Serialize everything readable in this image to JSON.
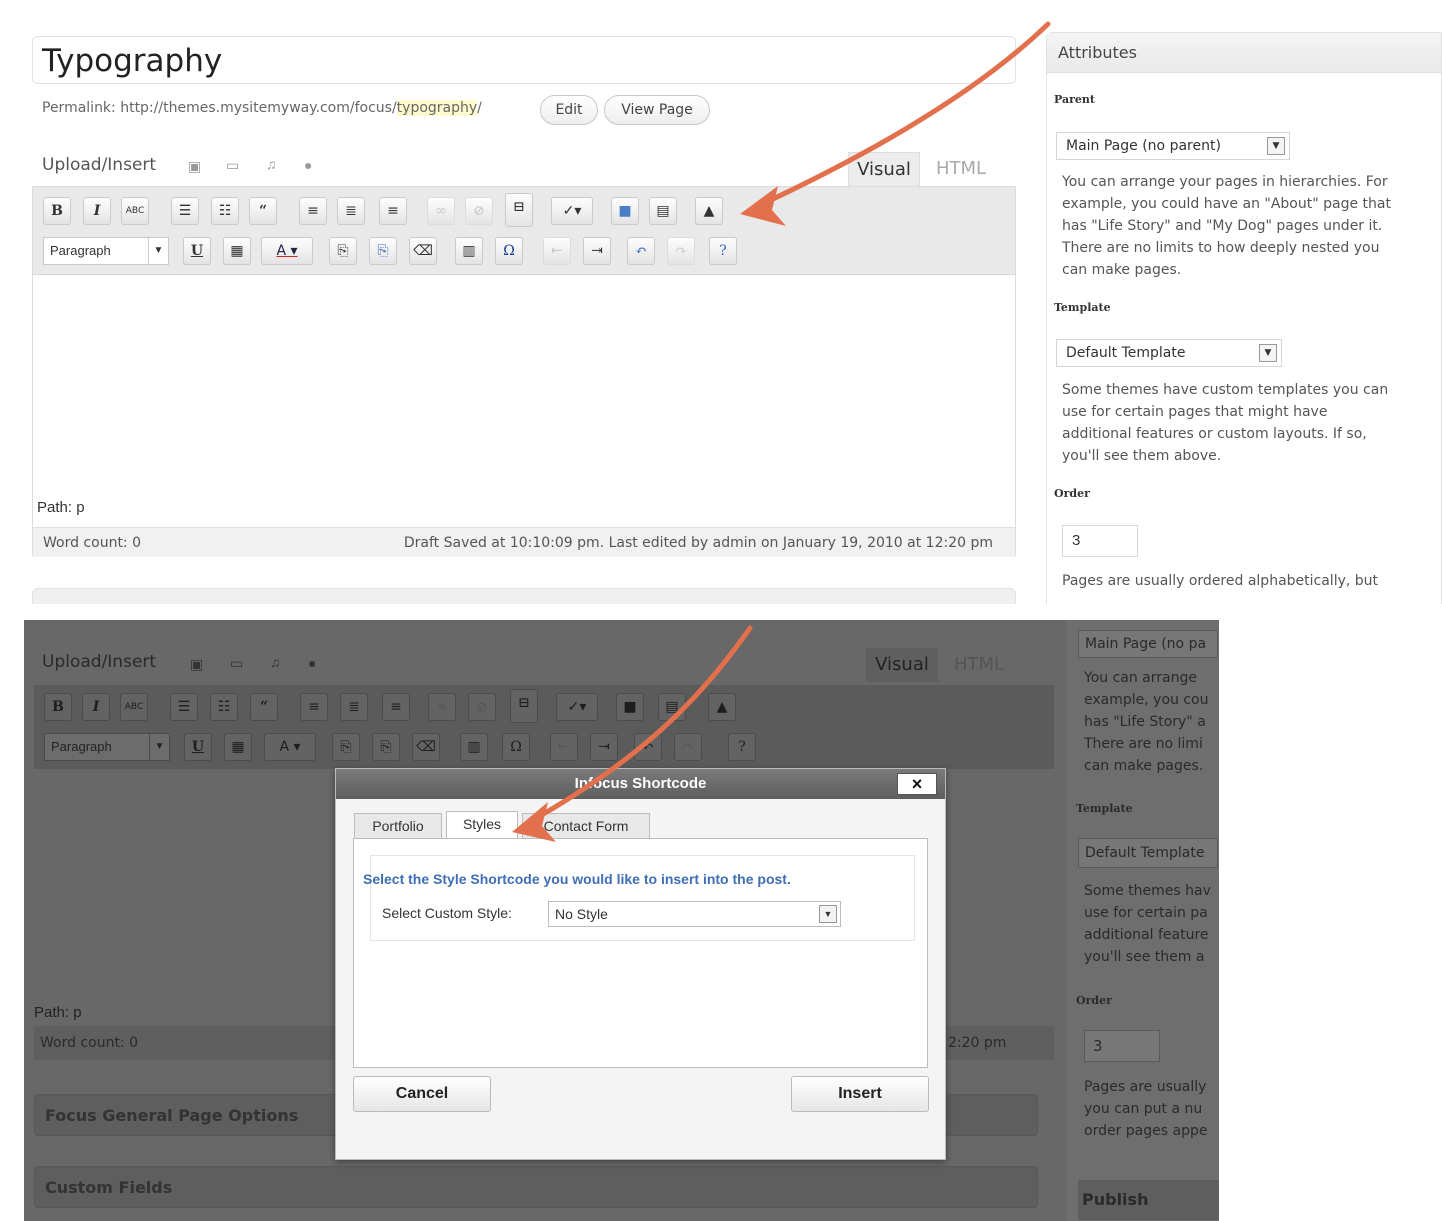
{
  "top": {
    "title": "Typography",
    "permalink": {
      "prefix": "Permalink: http://themes.mysitemyway.com/focus/",
      "slug": "typography",
      "suffix": "/",
      "edit_label": "Edit",
      "view_label": "View Page"
    },
    "upload_label": "Upload/Insert",
    "tabs": {
      "visual": "Visual",
      "html": "HTML"
    },
    "format_select": "Paragraph",
    "path": "Path: p",
    "word_count": "Word count: 0",
    "draft_status": "Draft Saved at 10:10:09 pm. Last edited by admin on January 19, 2010 at 12:20 pm",
    "attributes": {
      "title": "Attributes",
      "parent_label": "Parent",
      "parent_value": "Main Page (no parent)",
      "parent_help": [
        "You can arrange your pages in hierarchies. For",
        "example, you could have an \"About\" page that",
        "has \"Life Story\" and \"My Dog\" pages under it.",
        "There are no limits to how deeply nested you",
        "can make pages."
      ],
      "template_label": "Template",
      "template_value": "Default Template",
      "template_help": [
        "Some themes have custom templates you can",
        "use for certain pages that might have",
        "additional features or custom layouts. If so,",
        "you'll see them above."
      ],
      "order_label": "Order",
      "order_value": "3",
      "order_help": "Pages are usually ordered alphabetically, but"
    }
  },
  "bottom": {
    "upload_label": "Upload/Insert",
    "tabs": {
      "visual": "Visual",
      "html": "HTML"
    },
    "format_select": "Paragraph",
    "path": "Path: p",
    "word_count": "Word count: 0",
    "time_fragment": "2:20 pm",
    "section_focus": "Focus General Page Options",
    "section_custom": "Custom Fields",
    "side": {
      "parent_value": "Main Page (no pa",
      "help1": [
        "You can arrange",
        "example, you cou",
        "has \"Life Story\" a",
        "There are no limi",
        "can make pages."
      ],
      "template_label": "Template",
      "template_value": "Default Template",
      "help2": [
        "Some themes hav",
        "use for certain pa",
        "additional feature",
        "you'll see them a"
      ],
      "order_label": "Order",
      "order_value": "3",
      "help3": [
        "Pages are usually",
        "you can put a nu",
        "order pages appe"
      ],
      "publish": "Publish"
    }
  },
  "modal": {
    "title": "Infocus Shortcode",
    "close": "×",
    "tabs": [
      "Portfolio",
      "Styles",
      "Contact Form"
    ],
    "prompt": "Select the Style Shortcode you would like to insert into the post.",
    "select_label": "Select Custom Style:",
    "select_value": "No Style",
    "cancel": "Cancel",
    "insert": "Insert"
  },
  "colors": {
    "arrow": "#e2704d",
    "link_blue": "#3f6eb4",
    "dim_overlay": "#686868"
  },
  "icons": [
    "bold-icon",
    "italic-icon",
    "strikethrough-icon",
    "bullet-list-icon",
    "numbered-list-icon",
    "blockquote-icon",
    "align-left-icon",
    "align-center-icon",
    "align-right-icon",
    "link-icon",
    "unlink-icon",
    "more-tag-icon",
    "spellcheck-icon",
    "fullscreen-icon",
    "kitchen-sink-icon",
    "shortcode-icon",
    "underline-icon",
    "justify-icon",
    "text-color-icon",
    "paste-text-icon",
    "paste-word-icon",
    "clear-format-icon",
    "media-icon",
    "special-char-icon",
    "outdent-icon",
    "indent-icon",
    "undo-icon",
    "redo-icon",
    "help-icon",
    "image-icon",
    "video-icon",
    "audio-icon",
    "media-dot-icon"
  ]
}
